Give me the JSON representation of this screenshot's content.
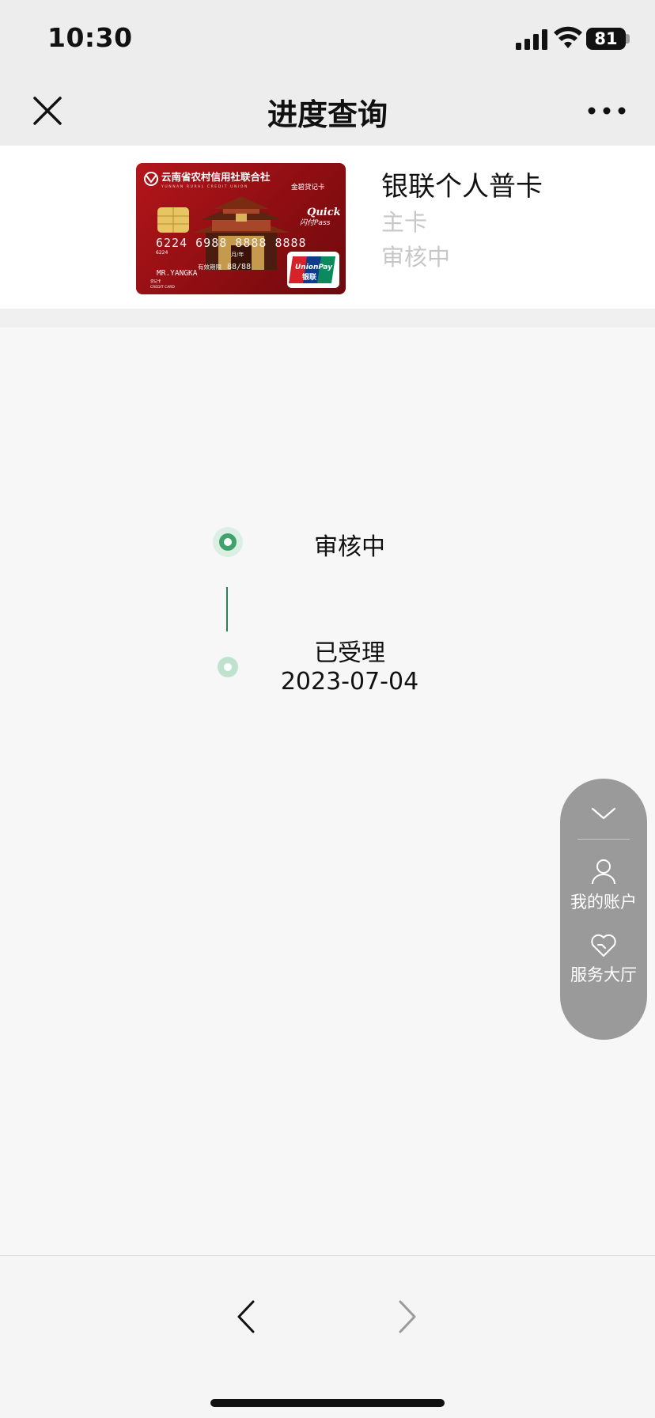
{
  "status_bar": {
    "time": "10:30",
    "battery": "81"
  },
  "nav": {
    "title": "进度查询"
  },
  "card": {
    "name": "银联个人普卡",
    "type": "主卡",
    "status": "审核中",
    "image": {
      "issuer": "云南省农村信用社联合社",
      "issuer_en": "YUNNAN RURAL CREDIT UNION",
      "product": "金碧贷记卡",
      "number": "6224 6988 8888 8888",
      "number_small": "6224",
      "valid_label": "有效期限",
      "valid_thru": "88/88",
      "month_year": "月/年",
      "holder": "MR.YANGKA",
      "quickpass_line1": "Quick",
      "quickpass_line2": "闪付Pass",
      "unionpay": "UnionPay",
      "unionpay_cn": "银联",
      "card_kind": "贷记卡",
      "card_kind_en": "CREDIT CARD"
    }
  },
  "timeline": {
    "steps": [
      {
        "label": "审核中",
        "date": ""
      },
      {
        "label": "已受理",
        "date": "2023-07-04"
      }
    ]
  },
  "float_panel": {
    "account_label": "我的账户",
    "service_label": "服务大厅"
  },
  "colors": {
    "accent_green": "#3ea46b",
    "card_red": "#b3161b",
    "panel_gray": "#9a9a9a"
  }
}
